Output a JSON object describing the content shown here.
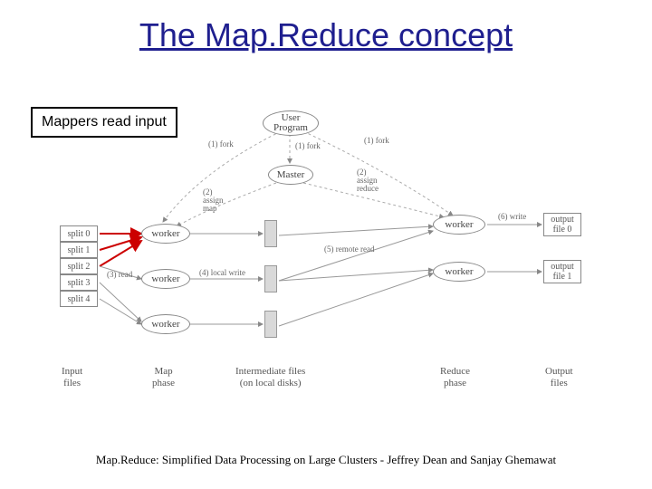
{
  "title": "The Map.Reduce concept",
  "annotation": "Mappers read input",
  "nodes": {
    "user_program": "User\nProgram",
    "master": "Master",
    "worker": "worker"
  },
  "splits": [
    "split 0",
    "split 1",
    "split 2",
    "split 3",
    "split 4"
  ],
  "outputs": [
    "output\nfile 0",
    "output\nfile 1"
  ],
  "edge_labels": {
    "fork1": "(1) fork",
    "fork2": "(1) fork",
    "fork3": "(1) fork",
    "assign_map": "(2)\nassign\nmap",
    "assign_reduce": "(2)\nassign\nreduce",
    "read": "(3) read",
    "local_write": "(4) local write",
    "remote_read": "(5) remote read",
    "write": "(6) write"
  },
  "phase_labels": {
    "input": "Input\nfiles",
    "map": "Map\nphase",
    "intermediate": "Intermediate files\n(on local disks)",
    "reduce": "Reduce\nphase",
    "output": "Output\nfiles"
  },
  "citation": "Map.Reduce: Simplified Data Processing on Large Clusters - Jeffrey Dean and Sanjay Ghemawat"
}
